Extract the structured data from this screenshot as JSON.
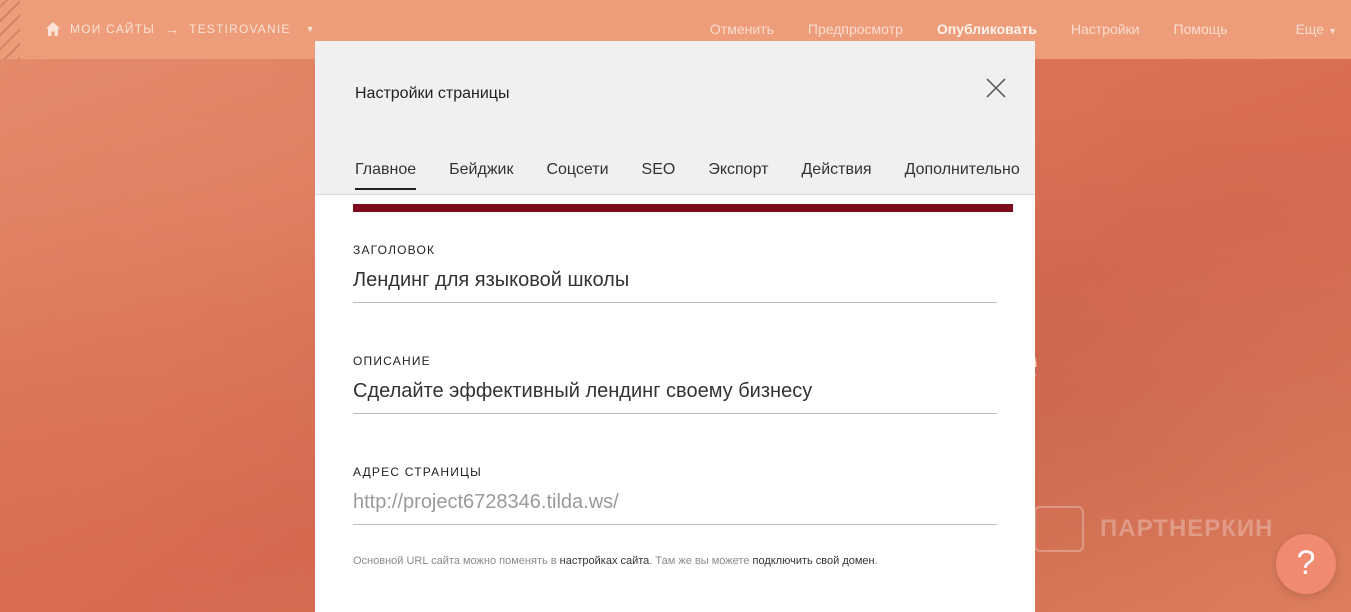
{
  "topbar": {
    "crumb_sites": "Мои сайты",
    "crumb_arrow": "→",
    "crumb_project": "TESTIROVANIE",
    "nav": {
      "cancel": "Отменить",
      "preview": "Предпросмотр",
      "publish": "Опубликовать",
      "settings": "Настройки",
      "help": "Помощь",
      "more": "Еще"
    }
  },
  "background": {
    "big_letter": "e",
    "watermark": "ПАРТНЕРКИН"
  },
  "modal": {
    "title": "Настройки страницы",
    "tabs": [
      {
        "label": "Главное",
        "active": true
      },
      {
        "label": "Бейджик"
      },
      {
        "label": "Соцсети"
      },
      {
        "label": "SEO"
      },
      {
        "label": "Экспорт"
      },
      {
        "label": "Действия"
      },
      {
        "label": "Дополнительно"
      }
    ],
    "fields": {
      "title_label": "Заголовок",
      "title_value": "Лендинг для языковой школы",
      "desc_label": "Описание",
      "desc_value": "Сделайте эффективный лендинг своему бизнесу",
      "url_label": "Адрес страницы",
      "url_value": "http://project6728346.tilda.ws/"
    },
    "note": {
      "part1": "Основной URL сайта можно поменять в ",
      "link1": "настройках сайта",
      "part2": ". Там же вы можете ",
      "link2": "подключить свой домен",
      "part3": "."
    }
  },
  "help_button": "?",
  "colors": {
    "accent_bar": "#7d0a1a",
    "topbar": "#ed9d7a",
    "help_button": "#f08a71"
  }
}
